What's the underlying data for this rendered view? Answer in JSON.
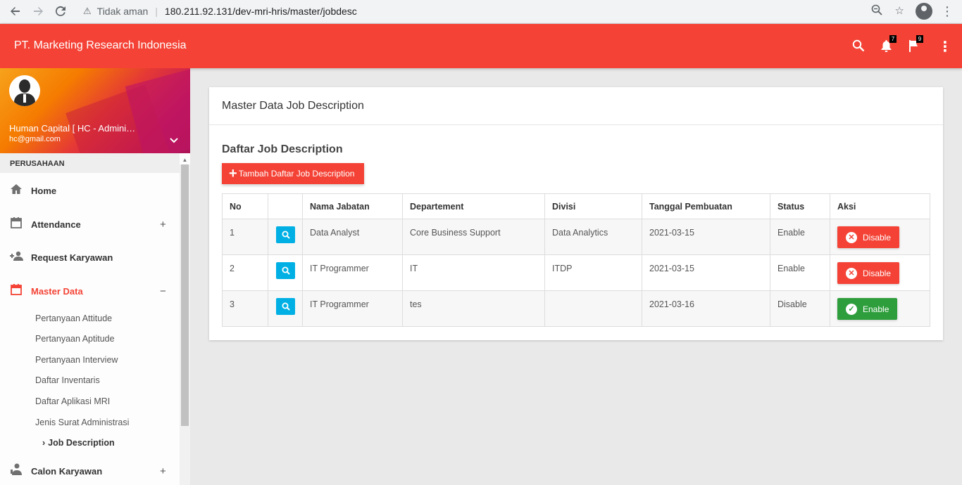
{
  "browser": {
    "security_label": "Tidak aman",
    "url": "180.211.92.131/dev-mri-hris/master/jobdesc"
  },
  "appbar": {
    "title": "PT. Marketing Research Indonesia",
    "notification_count": "7",
    "flag_count": "9"
  },
  "user": {
    "name": "Human Capital [ HC - Administ...",
    "email": "hc@gmail.com"
  },
  "sidebar": {
    "section_label": "PERUSAHAAN",
    "items": [
      {
        "label": "Home",
        "icon": "home-icon"
      },
      {
        "label": "Attendance",
        "icon": "calendar-icon",
        "toggle": "+"
      },
      {
        "label": "Request Karyawan",
        "icon": "people-add-icon"
      },
      {
        "label": "Master Data",
        "icon": "calendar-icon",
        "toggle": "−"
      },
      {
        "label": "Calon Karyawan",
        "icon": "person-icon",
        "toggle": "+"
      }
    ],
    "sub_items": [
      "Pertanyaan Attitude",
      "Pertanyaan Aptitude",
      "Pertanyaan Interview",
      "Daftar Inventaris",
      "Daftar Aplikasi MRI",
      "Jenis Surat Administrasi",
      "Job Description"
    ]
  },
  "page": {
    "title": "Master Data Job Description",
    "subtitle": "Daftar Job Description",
    "add_button": "Tambah Daftar Job Description"
  },
  "table": {
    "headers": [
      "No",
      "",
      "Nama Jabatan",
      "Departement",
      "Divisi",
      "Tanggal Pembuatan",
      "Status",
      "Aksi"
    ],
    "rows": [
      {
        "no": "1",
        "jabatan": "Data Analyst",
        "departement": "Core Business Support",
        "divisi": "Data Analytics",
        "tanggal": "2021-03-15",
        "status": "Enable",
        "aksi": "Disable"
      },
      {
        "no": "2",
        "jabatan": "IT Programmer",
        "departement": "IT",
        "divisi": "ITDP",
        "tanggal": "2021-03-15",
        "status": "Enable",
        "aksi": "Disable"
      },
      {
        "no": "3",
        "jabatan": "IT Programmer",
        "departement": "tes",
        "divisi": "",
        "tanggal": "2021-03-16",
        "status": "Disable",
        "aksi": "Enable"
      }
    ]
  },
  "colors": {
    "primary": "#f44336",
    "info": "#00b0e4",
    "success": "#2e9e3c"
  }
}
